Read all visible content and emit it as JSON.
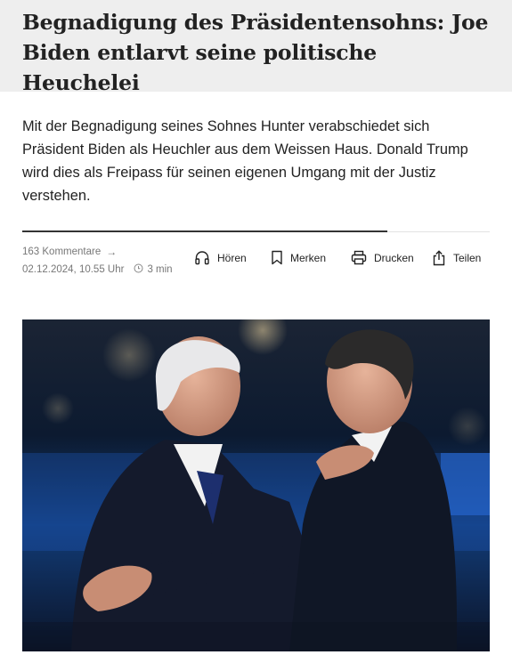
{
  "article": {
    "title": "Begnadigung des Präsidentensohns: Joe Biden entlarvt seine politische Heuchelei",
    "lead": "Mit der Begnadigung seines Sohnes Hunter verabschiedet sich Präsident Biden als Heuchler aus dem Weissen Haus. Donald Trump wird dies als Freipass für seinen eigenen Umgang mit der Justiz verstehen."
  },
  "meta": {
    "comments": "163 Kommentare",
    "date": "02.12.2024, 10.55 Uhr",
    "read_time": "3 min",
    "reading_progress": 0.78
  },
  "actions": {
    "listen": "Hören",
    "bookmark": "Merken",
    "print": "Drucken",
    "share": "Teilen"
  },
  "icons": {
    "listen": "headphones-icon",
    "bookmark": "bookmark-icon",
    "print": "printer-icon",
    "share": "share-icon",
    "comments_arrow": "arrow-right-icon",
    "read_time": "clock-icon"
  },
  "colors": {
    "header_background": "#eeeeee",
    "text": "#222222",
    "meta_text": "#777777"
  }
}
